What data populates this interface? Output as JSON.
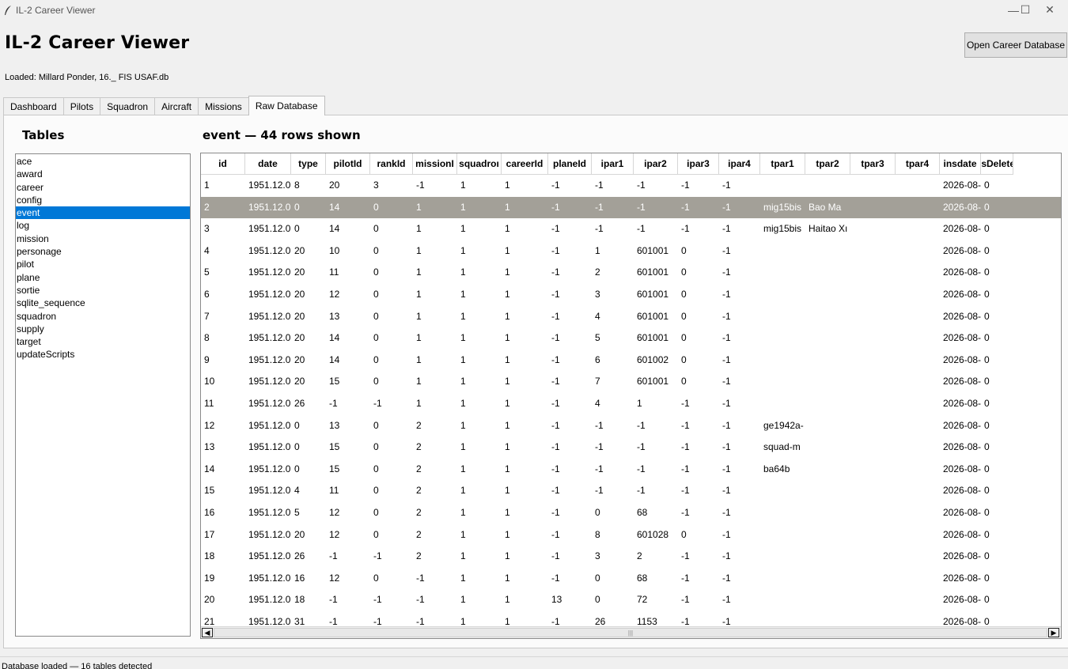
{
  "window": {
    "title": "IL-2 Career Viewer",
    "icon": "feather-icon",
    "controls": {
      "minimize": "—",
      "maximize": "☐",
      "close": "✕"
    }
  },
  "header": {
    "title": "IL-2 Career Viewer",
    "open_button": "Open Career Database",
    "loaded_text": "Loaded: Millard Ponder, 16._ FIS USAF.db"
  },
  "tabs": [
    {
      "label": "Dashboard",
      "active": false
    },
    {
      "label": "Pilots",
      "active": false
    },
    {
      "label": "Squadron",
      "active": false
    },
    {
      "label": "Aircraft",
      "active": false
    },
    {
      "label": "Missions",
      "active": false
    },
    {
      "label": "Raw Database",
      "active": true
    }
  ],
  "tables_panel": {
    "title": "Tables",
    "selected": "event",
    "items": [
      "ace",
      "award",
      "career",
      "config",
      "event",
      "log",
      "mission",
      "personage",
      "pilot",
      "plane",
      "sortie",
      "sqlite_sequence",
      "squadron",
      "supply",
      "target",
      "updateScripts"
    ]
  },
  "grid": {
    "title": "event — 44 rows shown",
    "columns": [
      "id",
      "date",
      "type",
      "pilotId",
      "rankId",
      "missionI",
      "squadroı",
      "careerId",
      "planeId",
      "ipar1",
      "ipar2",
      "ipar3",
      "ipar4",
      "tpar1",
      "tpar2",
      "tpar3",
      "tpar4",
      "insdate",
      "isDelete"
    ],
    "selected_row": 1,
    "rows": [
      [
        "1",
        "1951.12.0",
        "8",
        "20",
        "3",
        "-1",
        "1",
        "1",
        "-1",
        "-1",
        "-1",
        "-1",
        "-1",
        "",
        "",
        "",
        "",
        "2026-08-·",
        "0"
      ],
      [
        "2",
        "1951.12.0",
        "0",
        "14",
        "0",
        "1",
        "1",
        "1",
        "-1",
        "-1",
        "-1",
        "-1",
        "-1",
        "mig15bis",
        "Bao Ma",
        "",
        "",
        "2026-08-·",
        "0"
      ],
      [
        "3",
        "1951.12.0",
        "0",
        "14",
        "0",
        "1",
        "1",
        "1",
        "-1",
        "-1",
        "-1",
        "-1",
        "-1",
        "mig15bis",
        "Haitao Xı",
        "",
        "",
        "2026-08-·",
        "0"
      ],
      [
        "4",
        "1951.12.0",
        "20",
        "10",
        "0",
        "1",
        "1",
        "1",
        "-1",
        "1",
        "601001",
        "0",
        "-1",
        "",
        "",
        "",
        "",
        "2026-08-·",
        "0"
      ],
      [
        "5",
        "1951.12.0",
        "20",
        "11",
        "0",
        "1",
        "1",
        "1",
        "-1",
        "2",
        "601001",
        "0",
        "-1",
        "",
        "",
        "",
        "",
        "2026-08-·",
        "0"
      ],
      [
        "6",
        "1951.12.0",
        "20",
        "12",
        "0",
        "1",
        "1",
        "1",
        "-1",
        "3",
        "601001",
        "0",
        "-1",
        "",
        "",
        "",
        "",
        "2026-08-·",
        "0"
      ],
      [
        "7",
        "1951.12.0",
        "20",
        "13",
        "0",
        "1",
        "1",
        "1",
        "-1",
        "4",
        "601001",
        "0",
        "-1",
        "",
        "",
        "",
        "",
        "2026-08-·",
        "0"
      ],
      [
        "8",
        "1951.12.0",
        "20",
        "14",
        "0",
        "1",
        "1",
        "1",
        "-1",
        "5",
        "601001",
        "0",
        "-1",
        "",
        "",
        "",
        "",
        "2026-08-·",
        "0"
      ],
      [
        "9",
        "1951.12.0",
        "20",
        "14",
        "0",
        "1",
        "1",
        "1",
        "-1",
        "6",
        "601002",
        "0",
        "-1",
        "",
        "",
        "",
        "",
        "2026-08-·",
        "0"
      ],
      [
        "10",
        "1951.12.0",
        "20",
        "15",
        "0",
        "1",
        "1",
        "1",
        "-1",
        "7",
        "601001",
        "0",
        "-1",
        "",
        "",
        "",
        "",
        "2026-08-·",
        "0"
      ],
      [
        "11",
        "1951.12.0",
        "26",
        "-1",
        "-1",
        "1",
        "1",
        "1",
        "-1",
        "4",
        "1",
        "-1",
        "-1",
        "",
        "",
        "",
        "",
        "2026-08-·",
        "0"
      ],
      [
        "12",
        "1951.12.0",
        "0",
        "13",
        "0",
        "2",
        "1",
        "1",
        "-1",
        "-1",
        "-1",
        "-1",
        "-1",
        "ge1942a-",
        "",
        "",
        "",
        "2026-08-·",
        "0"
      ],
      [
        "13",
        "1951.12.0",
        "0",
        "15",
        "0",
        "2",
        "1",
        "1",
        "-1",
        "-1",
        "-1",
        "-1",
        "-1",
        "squad-m",
        "",
        "",
        "",
        "2026-08-·",
        "0"
      ],
      [
        "14",
        "1951.12.0",
        "0",
        "15",
        "0",
        "2",
        "1",
        "1",
        "-1",
        "-1",
        "-1",
        "-1",
        "-1",
        "ba64b",
        "",
        "",
        "",
        "2026-08-·",
        "0"
      ],
      [
        "15",
        "1951.12.0",
        "4",
        "11",
        "0",
        "2",
        "1",
        "1",
        "-1",
        "-1",
        "-1",
        "-1",
        "-1",
        "",
        "",
        "",
        "",
        "2026-08-·",
        "0"
      ],
      [
        "16",
        "1951.12.0",
        "5",
        "12",
        "0",
        "2",
        "1",
        "1",
        "-1",
        "0",
        "68",
        "-1",
        "-1",
        "",
        "",
        "",
        "",
        "2026-08-·",
        "0"
      ],
      [
        "17",
        "1951.12.0",
        "20",
        "12",
        "0",
        "2",
        "1",
        "1",
        "-1",
        "8",
        "601028",
        "0",
        "-1",
        "",
        "",
        "",
        "",
        "2026-08-·",
        "0"
      ],
      [
        "18",
        "1951.12.0",
        "26",
        "-1",
        "-1",
        "2",
        "1",
        "1",
        "-1",
        "3",
        "2",
        "-1",
        "-1",
        "",
        "",
        "",
        "",
        "2026-08-·",
        "0"
      ],
      [
        "19",
        "1951.12.0",
        "16",
        "12",
        "0",
        "-1",
        "1",
        "1",
        "-1",
        "0",
        "68",
        "-1",
        "-1",
        "",
        "",
        "",
        "",
        "2026-08-·",
        "0"
      ],
      [
        "20",
        "1951.12.0",
        "18",
        "-1",
        "-1",
        "-1",
        "1",
        "1",
        "13",
        "0",
        "72",
        "-1",
        "-1",
        "",
        "",
        "",
        "",
        "2026-08-·",
        "0"
      ],
      [
        "21",
        "1951.12.0",
        "31",
        "-1",
        "-1",
        "-1",
        "1",
        "1",
        "-1",
        "26",
        "1153",
        "-1",
        "-1",
        "",
        "",
        "",
        "",
        "2026-08-·",
        "0"
      ]
    ]
  },
  "scrollbar": {
    "left_arrow": "◀",
    "right_arrow": "▶",
    "grip": "|||"
  },
  "status": "Database loaded — 16 tables detected"
}
